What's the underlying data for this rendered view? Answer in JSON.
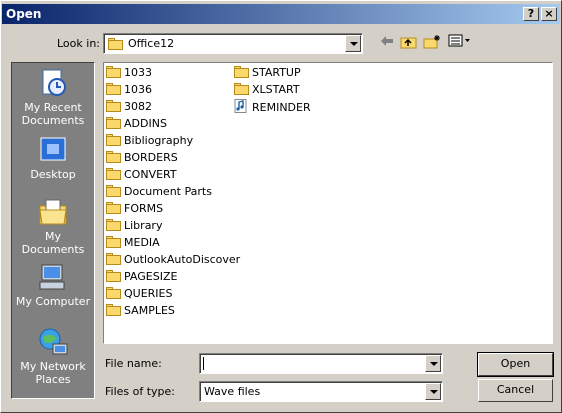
{
  "window": {
    "title": "Open",
    "help_label": "?",
    "close_label": "×"
  },
  "lookin": {
    "label": "Look in:",
    "value": "Office12"
  },
  "toolbar": {
    "back_icon": "back-arrow-icon",
    "up_icon": "up-folder-icon",
    "new_folder_icon": "new-folder-icon",
    "views_icon": "views-menu-icon"
  },
  "places": [
    {
      "label": "My Recent Documents",
      "icon": "recent-documents-icon"
    },
    {
      "label": "Desktop",
      "icon": "desktop-icon"
    },
    {
      "label": "My Documents",
      "icon": "my-documents-icon"
    },
    {
      "label": "My Computer",
      "icon": "my-computer-icon"
    },
    {
      "label": "My Network Places",
      "icon": "network-places-icon"
    }
  ],
  "files": {
    "col1": [
      "1033",
      "1036",
      "3082",
      "ADDINS",
      "Bibliography",
      "BORDERS",
      "CONVERT",
      "Document Parts",
      "FORMS",
      "Library",
      "MEDIA",
      "OutlookAutoDiscover",
      "PAGESIZE",
      "QUERIES",
      "SAMPLES"
    ],
    "col2": [
      {
        "name": "STARTUP",
        "type": "folder"
      },
      {
        "name": "XLSTART",
        "type": "folder"
      },
      {
        "name": "REMINDER",
        "type": "audio"
      }
    ]
  },
  "filename": {
    "label": "File name:",
    "value": ""
  },
  "filetype": {
    "label": "Files of type:",
    "value": "Wave files"
  },
  "buttons": {
    "open": "Open",
    "cancel": "Cancel"
  },
  "colors": {
    "title_start": "#0a246a",
    "title_end": "#a6caf0",
    "face": "#d4d0c8",
    "places_bg": "#808080",
    "folder": "#f9d96b"
  }
}
